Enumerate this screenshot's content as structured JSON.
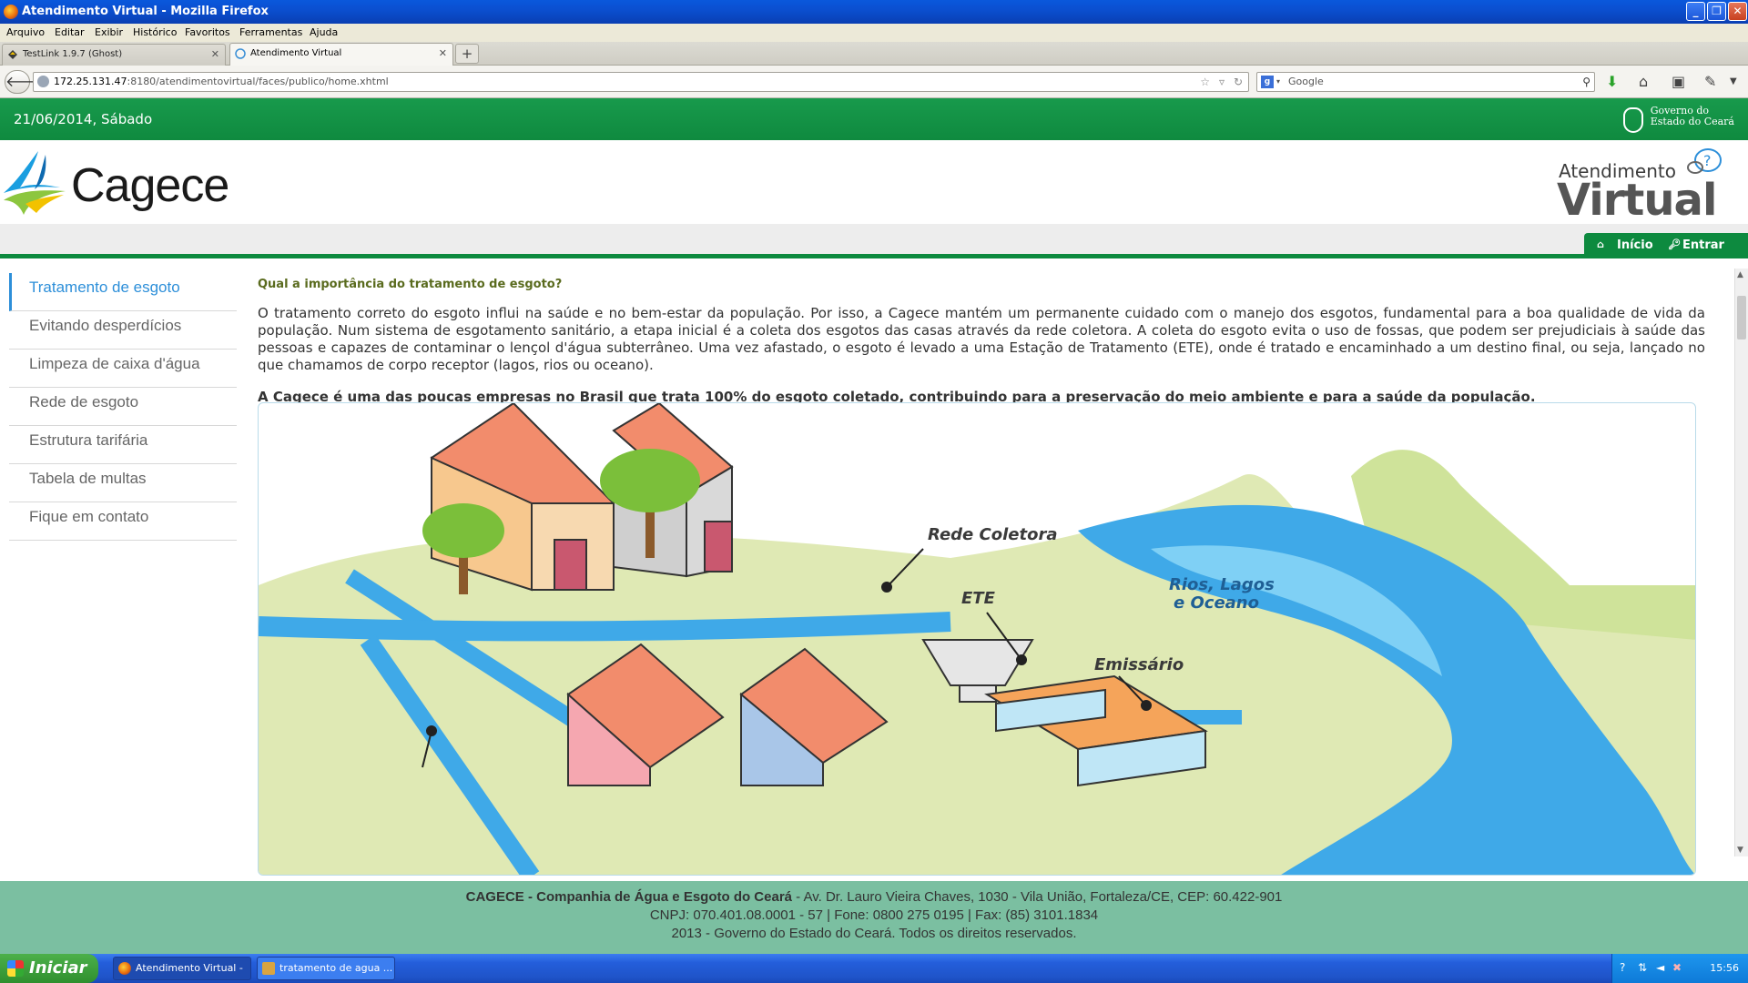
{
  "window": {
    "title": "Atendimento Virtual - Mozilla Firefox"
  },
  "menu": [
    "Arquivo",
    "Editar",
    "Exibir",
    "Histórico",
    "Favoritos",
    "Ferramentas",
    "Ajuda"
  ],
  "tabs": [
    {
      "label": "TestLink 1.9.7 (Ghost)",
      "active": false
    },
    {
      "label": "Atendimento Virtual",
      "active": true
    }
  ],
  "address": {
    "host": "172.25.131.47",
    "rest": ":8180/atendimentovirtual/faces/publico/home.xhtml"
  },
  "search": {
    "placeholder": "Google"
  },
  "site": {
    "date": "21/06/2014, Sábado",
    "gov_line1": "Governo do",
    "gov_line2": "Estado do Ceará",
    "logo_text": "Cagece",
    "brand_line1": "Atendimento",
    "brand_line2": "Virtual",
    "nav_home": "Início",
    "nav_login": "Entrar"
  },
  "sidebar": [
    {
      "label": "Tratamento de esgoto",
      "active": true
    },
    {
      "label": "Evitando desperdícios",
      "active": false
    },
    {
      "label": "Limpeza de caixa d'água",
      "active": false
    },
    {
      "label": "Rede de esgoto",
      "active": false
    },
    {
      "label": "Estrutura tarifária",
      "active": false
    },
    {
      "label": "Tabela de multas",
      "active": false
    },
    {
      "label": "Fique em contato",
      "active": false
    }
  ],
  "article": {
    "question": "Qual a importância do tratamento de esgoto?",
    "paragraph": "O tratamento correto do esgoto influi na saúde e no bem-estar da população. Por isso, a Cagece mantém um permanente cuidado com o manejo dos esgotos, fundamental para a boa qualidade de vida da população. Num sistema de esgotamento sanitário, a etapa inicial é a coleta dos esgotos das casas através da rede coletora. A coleta do esgoto evita o uso de fossas, que podem ser prejudiciais à saúde das pessoas e capazes de contaminar o lençol d'água subterrâneo. Uma vez afastado, o esgoto é levado a uma Estação de Tratamento (ETE), onde é tratado e encaminhado a um destino final, ou seja, lançado no que chamamos de corpo receptor (lagos, rios ou oceano).",
    "bold": "A Cagece é uma das poucas empresas no Brasil que trata 100% do esgoto coletado, contribuindo para a preservação do meio ambiente e para a saúde da população."
  },
  "illustration": {
    "label_rede": "Rede Coletora",
    "label_ete": "ETE",
    "label_rios1": "Rios, Lagos",
    "label_rios2": "e Oceano",
    "label_emissario": "Emissário"
  },
  "footer": {
    "company": "CAGECE - Companhia de Água e Esgoto do Ceará",
    "address": " - Av. Dr. Lauro Vieira Chaves, 1030 - Vila União, Fortaleza/CE, CEP: 60.422-901",
    "line2": "CNPJ: 070.401.08.0001 - 57 | Fone: 0800 275 0195 | Fax: (85) 3101.1834",
    "line3": "2013 - Governo do Estado do Ceará. Todos os direitos reservados."
  },
  "taskbar": {
    "start": "Iniciar",
    "tasks": [
      {
        "label": "Atendimento Virtual - ..."
      },
      {
        "label": "tratamento de agua ..."
      }
    ],
    "clock": "15:56"
  },
  "colors": {
    "green": "#0d8a3f",
    "link_blue": "#2d8fd9",
    "footer_green": "#7bbfa1"
  }
}
